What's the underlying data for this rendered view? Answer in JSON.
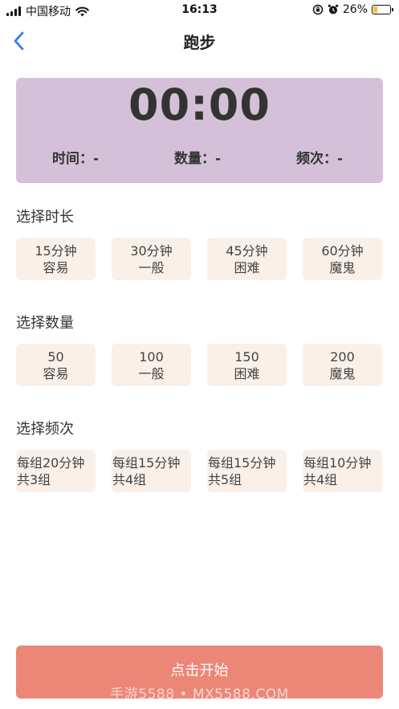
{
  "status_bar": {
    "carrier": "中国移动",
    "time": "16:13",
    "battery_percent": "26%",
    "battery_level": 0.26,
    "icons": [
      "signal-icon",
      "wifi-icon",
      "lock-rotation-icon",
      "alarm-icon",
      "battery-icon"
    ]
  },
  "nav": {
    "title": "跑步",
    "back_icon": "chevron-left-icon"
  },
  "timer": {
    "display": "00:00",
    "time_label": "时间：-",
    "count_label": "数量：-",
    "freq_label": "频次：-"
  },
  "duration": {
    "title": "选择时长",
    "options": [
      {
        "line1": "15分钟",
        "line2": "容易"
      },
      {
        "line1": "30分钟",
        "line2": "一般"
      },
      {
        "line1": "45分钟",
        "line2": "困难"
      },
      {
        "line1": "60分钟",
        "line2": "魔鬼"
      }
    ]
  },
  "quantity": {
    "title": "选择数量",
    "options": [
      {
        "line1": "50",
        "line2": "容易"
      },
      {
        "line1": "100",
        "line2": "一般"
      },
      {
        "line1": "150",
        "line2": "困难"
      },
      {
        "line1": "200",
        "line2": "魔鬼"
      }
    ]
  },
  "frequency": {
    "title": "选择频次",
    "options": [
      {
        "line1": "每组20分钟",
        "line2": "共3组"
      },
      {
        "line1": "每组15分钟",
        "line2": "共4组"
      },
      {
        "line1": "每组15分钟",
        "line2": "共5组"
      },
      {
        "line1": "每组10分钟",
        "line2": "共4组"
      }
    ]
  },
  "start_button": "点击开始",
  "watermark": "手游5588 • MX5588.COM",
  "colors": {
    "timer_card": "#d5c0d9",
    "option_bg": "#faf0e8",
    "start_button": "#ec8777",
    "back_icon": "#3478f6",
    "battery_fill": "#f4c430"
  }
}
